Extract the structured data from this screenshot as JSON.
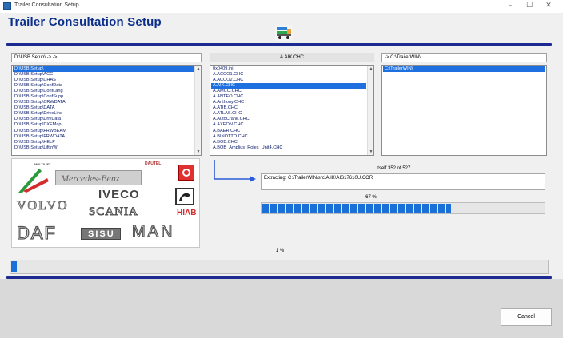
{
  "window": {
    "title": "Trailer Consultation Setup",
    "controls": {
      "minimize": "–",
      "maximize": "☐",
      "close": "✕"
    }
  },
  "heading": "Trailer Consultation  Setup",
  "source": {
    "header": "D:\\USB Setup\\ -> ->",
    "items": [
      "D:\\USB Setup\\",
      "D:\\USB Setup\\ACC",
      "D:\\USB Setup\\CHAS",
      "D:\\USB Setup\\ConfData",
      "D:\\USB Setup\\ConfLang",
      "D:\\USB Setup\\ConfSupp",
      "D:\\USB Setup\\CRWDATA",
      "D:\\USB Setup\\DATA",
      "D:\\USB Setup\\DriveLine",
      "D:\\USB Setup\\DrivData",
      "D:\\USB Setup\\DXFMap",
      "D:\\USB Setup\\FRWBEAM",
      "D:\\USB Setup\\FRWDATA",
      "D:\\USB Setup\\HELP",
      "D:\\USB Setup\\LiftinW"
    ],
    "selected_index": 0
  },
  "files": {
    "header": "A.AIK.CHC",
    "items": [
      "0x0409.ini",
      "A.ACCO1.CHC",
      "A.ACCO2.CHC",
      "A.AIK.CHC",
      "A.AMCO.CHC",
      "A.ANTEO.CHC",
      "A.Anthony.CHC",
      "A.ATIB.CHC",
      "A.ATLAS.CHC",
      "A.AutoCrane.CHC",
      "A.AXEON.CHC",
      "A.BAER.CHC",
      "A.BINOTTO.CHC",
      "A.BOB.CHC",
      "A.BOB_Amplius_Roles_Unit4.CHC"
    ],
    "selected_index": 3
  },
  "destination": {
    "header": "-> C:\\TrailerWIN\\",
    "items": [
      "C:\\TrailerWIN\\"
    ],
    "selected_index": 0
  },
  "logos": {
    "multilift": "MULTILIFT",
    "dautel": "DAUTEL",
    "mercedes": "Mercedes-Benz",
    "iveco": "IVECO",
    "volvo": "VOLVO",
    "scania": "SCANIA",
    "hiab": "HIAB",
    "daf": "DAF",
    "sisu": "SISU",
    "man": "MAN"
  },
  "status": {
    "file_count": "Itself 352 of 527",
    "extracting": "Extracting: C:\\TrailerWIN\\src\\A.IK\\AIS17610U.COR",
    "percent_label": "67 %",
    "percent": 0.67,
    "total_label": "1 %",
    "total_percent": 0.01
  },
  "buttons": {
    "cancel": "Cancel"
  },
  "colors": {
    "heading": "#0b2f8a",
    "rule": "#1c2a92",
    "progress": "#1a6fd8",
    "selection": "#1e70e0"
  }
}
